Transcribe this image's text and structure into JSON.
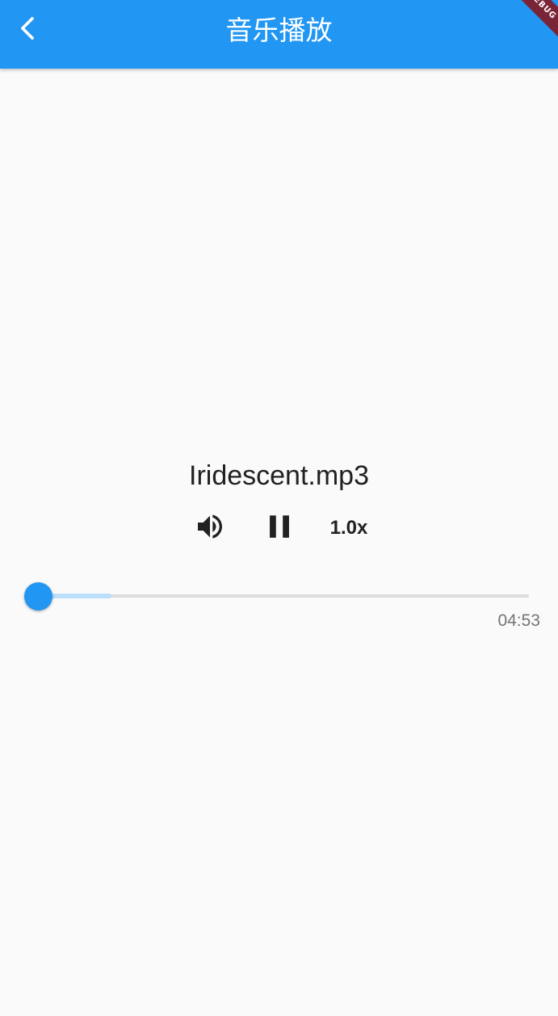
{
  "app_bar": {
    "title": "音乐播放",
    "back_icon": "chevron-left-icon",
    "background_color": "#2196f3",
    "debug_banner_label": "DEBUG"
  },
  "player": {
    "track_title": "Iridescent.mp3",
    "volume_icon": "volume-up-icon",
    "play_state_icon": "pause-icon",
    "speed_label": "1.0x",
    "progress_fraction": 0.0,
    "buffered_fraction": 0.15,
    "duration": "04:53",
    "accent_color": "#2196f3",
    "buffer_color": "#bbdefb"
  }
}
